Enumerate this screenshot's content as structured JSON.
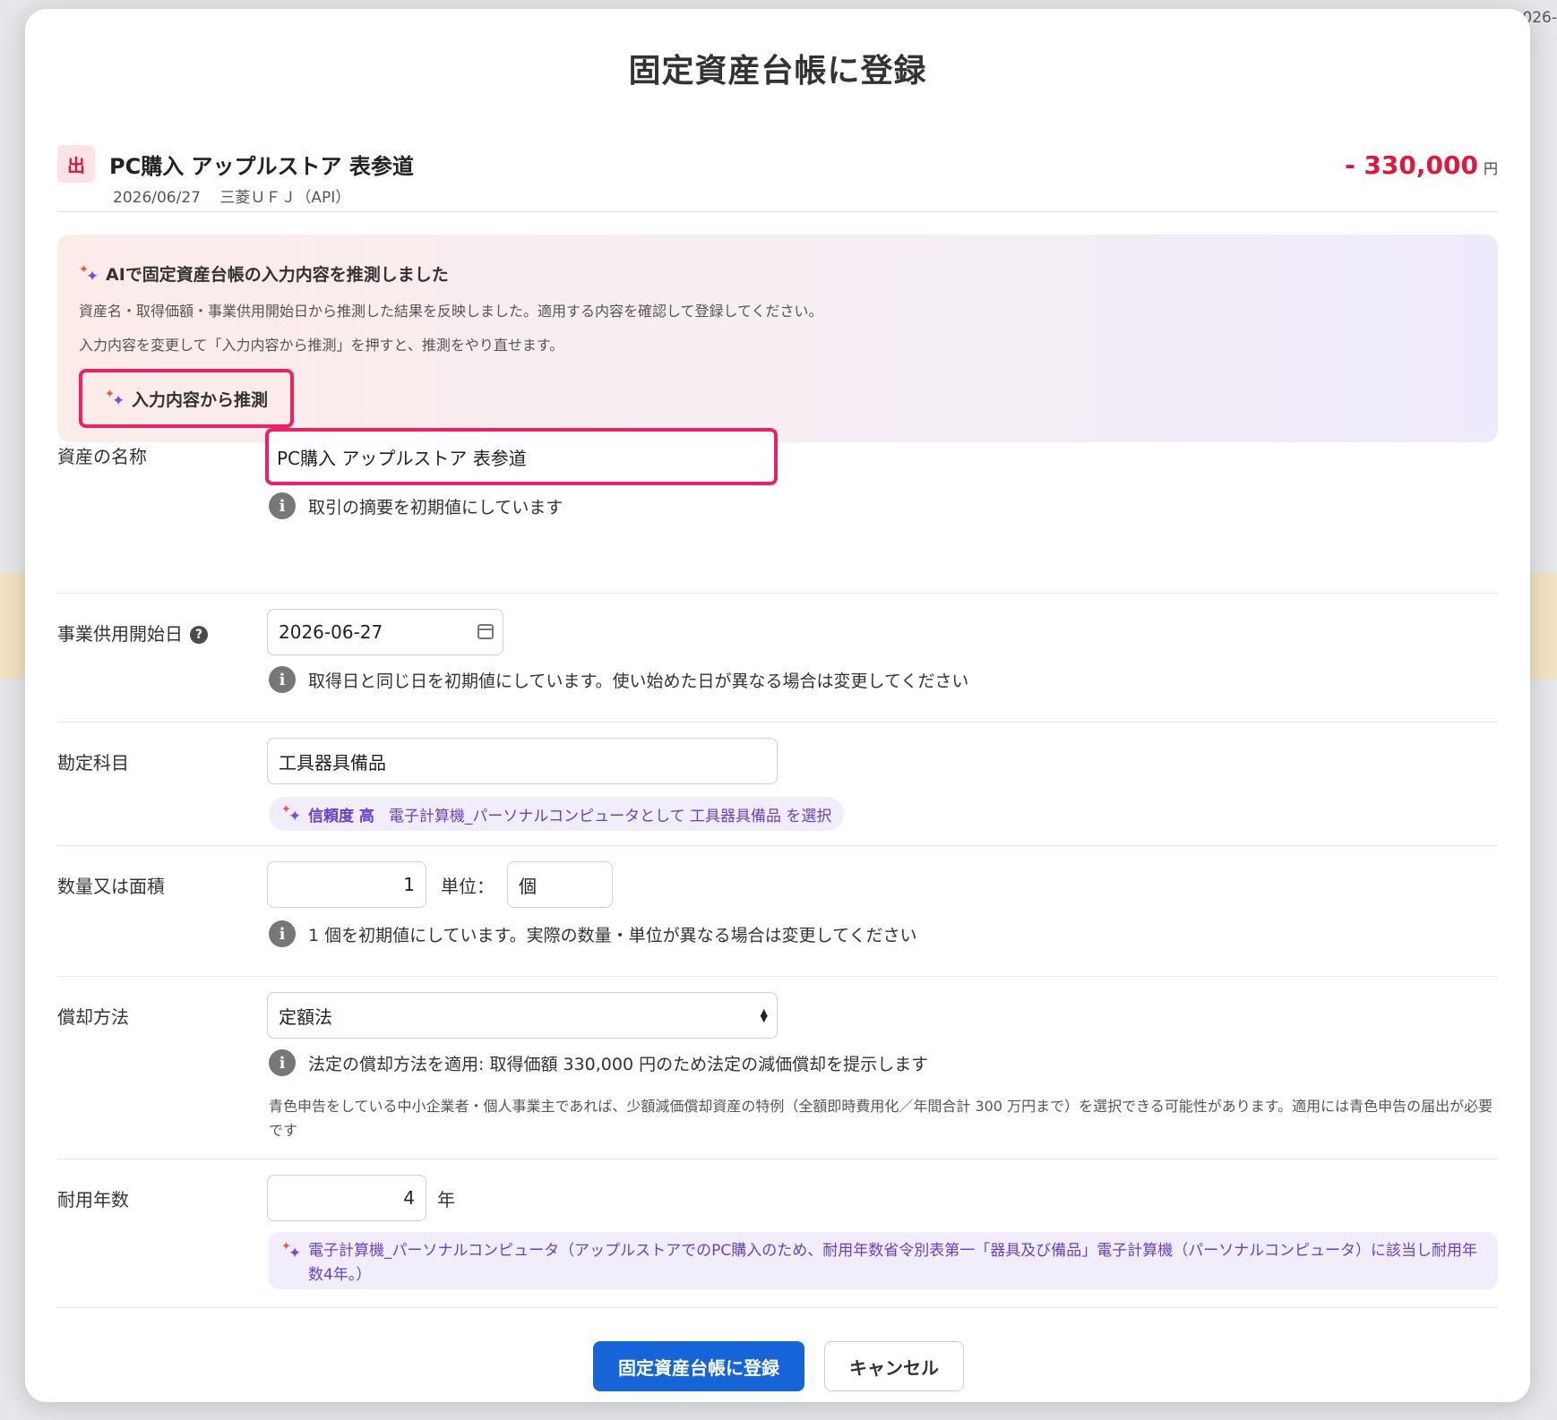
{
  "background": {
    "date_fragment": "026-"
  },
  "modal": {
    "title": "固定資産台帳に登録",
    "transaction": {
      "badge": "出",
      "name": "PC購入 アップルストア 表参道",
      "date": "2026/06/27",
      "account": "三菱ＵＦＪ（API）",
      "amount": "- 330,000",
      "amount_unit": "円"
    },
    "ai_box": {
      "heading": "AIで固定資産台帳の入力内容を推測しました",
      "line1": "資産名・取得価額・事業供用開始日から推測した結果を反映しました。適用する内容を確認して登録してください。",
      "line2": "入力内容を変更して「入力内容から推測」を押すと、推測をやり直せます。",
      "button_label": "入力内容から推測"
    },
    "fields": {
      "asset_name": {
        "label": "資産の名称",
        "value": "PC購入 アップルストア 表参道",
        "info": "取引の摘要を初期値にしています"
      },
      "start_date": {
        "label": "事業供用開始日",
        "value": "2026-06-27",
        "info": "取得日と同じ日を初期値にしています。使い始めた日が異なる場合は変更してください"
      },
      "account_title": {
        "label": "勘定科目",
        "value": "工具器具備品",
        "confidence_label": "信頼度 高",
        "confidence_text": "電子計算機_パーソナルコンピュータとして 工具器具備品 を選択"
      },
      "quantity": {
        "label": "数量又は面積",
        "value": "1",
        "unit_label": "単位：",
        "unit_value": "個",
        "info": "1 個を初期値にしています。実際の数量・単位が異なる場合は変更してください"
      },
      "depreciation": {
        "label": "償却方法",
        "value": "定額法",
        "info": "法定の償却方法を適用: 取得価額 330,000 円のため法定の減価償却を提示します",
        "note": "青色申告をしている中小企業者・個人事業主であれば、少額減価償却資産の特例（全額即時費用化／年間合計 300 万円まで）を選択できる可能性があります。適用には青色申告の届出が必要です"
      },
      "useful_life": {
        "label": "耐用年数",
        "value": "4",
        "unit": "年",
        "ai_note": "電子計算機_パーソナルコンピュータ（アップルストアでのPC購入のため、耐用年数省令別表第一「器具及び備品」電子計算機（パーソナルコンピュータ）に該当し耐用年数4年。）"
      }
    },
    "buttons": {
      "submit": "固定資産台帳に登録",
      "cancel": "キャンセル"
    }
  },
  "colors": {
    "accent": "#1565d8",
    "highlight": "#ee1f64",
    "negative": "#e0173b",
    "ai_purple": "#6a40c9"
  }
}
